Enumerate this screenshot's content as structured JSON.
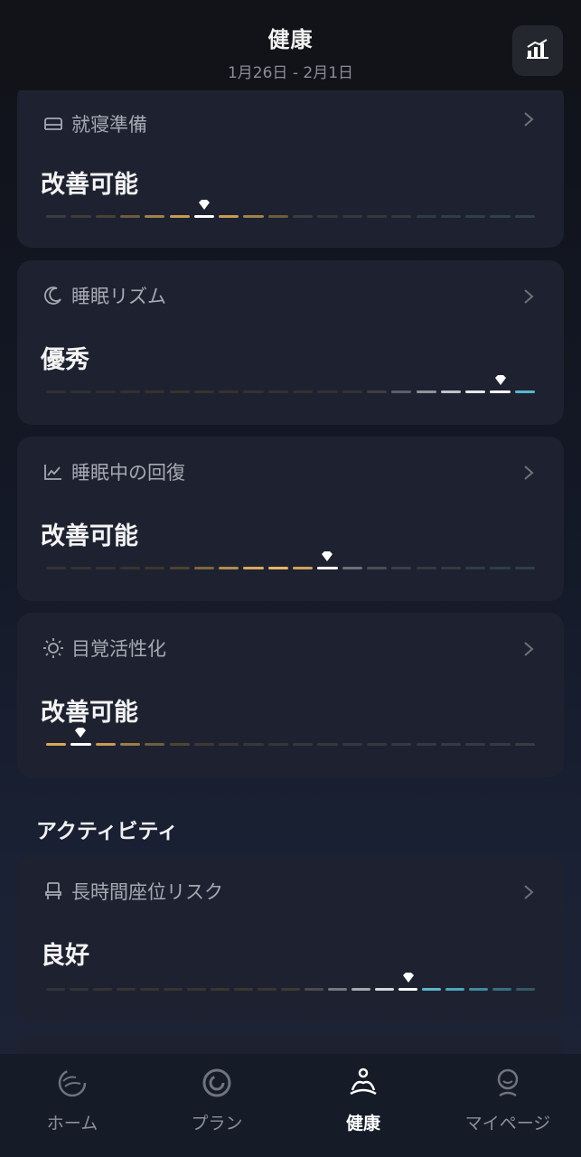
{
  "header": {
    "title": "健康",
    "date_range": "1月26日 - 2月1日",
    "stats_icon": "bar-chart-icon"
  },
  "cards": [
    {
      "id": "sleep-prep",
      "icon": "bed-icon",
      "label": "就寝準備",
      "rating": "改善可能",
      "marker_index": 6,
      "segment_colors": [
        "#3a3c42",
        "#3e3c3a",
        "#4a4234",
        "#6d5b3b",
        "#a0814a",
        "#c99a52",
        "#e6b062",
        "#c99a52",
        "#a0814a",
        "#6d5b3b",
        "#3a3c42",
        "#34383f",
        "#34383f",
        "#34383f",
        "#34383f",
        "#2f3a44",
        "#2e3d48",
        "#2e3e4a",
        "#2f3f4b",
        "#30404c"
      ]
    },
    {
      "id": "sleep-rhythm",
      "icon": "moon-icon",
      "label": "睡眠リズム",
      "rating": "優秀",
      "marker_index": 18,
      "segment_colors": [
        "#2f3034",
        "#2f3034",
        "#302f30",
        "#33302e",
        "#35312d",
        "#36322d",
        "#37332e",
        "#36322e",
        "#34312f",
        "#333131",
        "#323133",
        "#313134",
        "#323236",
        "#3c3e44",
        "#5c5f67",
        "#8e9299",
        "#bfc3c9",
        "#e4e6ea",
        "#6cc6d8",
        "#58b7cd"
      ]
    },
    {
      "id": "sleep-recovery",
      "icon": "line-chart-icon",
      "label": "睡眠中の回復",
      "rating": "改善可能",
      "marker_index": 11,
      "segment_colors": [
        "#323336",
        "#343334",
        "#363332",
        "#38342f",
        "#3c362e",
        "#4d4230",
        "#7c6540",
        "#b08d50",
        "#d8a95c",
        "#e8b565",
        "#d1a25a",
        "#8d9096",
        "#6d7077",
        "#4a4d54",
        "#3b3f47",
        "#34393f",
        "#2f3b44",
        "#2e3c47",
        "#2e3d48",
        "#2f3e4a"
      ]
    },
    {
      "id": "wake-activation",
      "icon": "sun-icon",
      "label": "目覚活性化",
      "rating": "改善可能",
      "marker_index": 1,
      "segment_colors": [
        "#d8a95c",
        "#e8b565",
        "#c89b55",
        "#9c7d48",
        "#6f5d3e",
        "#4d4535",
        "#3b3a38",
        "#36383b",
        "#34373c",
        "#33373d",
        "#33373e",
        "#33383f",
        "#333940",
        "#333941",
        "#333a42",
        "#333a43",
        "#333b44",
        "#333b45",
        "#333c46",
        "#343d47"
      ]
    },
    {
      "id": "sitting-risk",
      "icon": "chair-icon",
      "label": "長時間座位リスク",
      "rating": "良好",
      "marker_index": 15,
      "segment_colors": [
        "#323336",
        "#333335",
        "#343334",
        "#353433",
        "#363432",
        "#373531",
        "#383530",
        "#393630",
        "#3a3630",
        "#3b3730",
        "#3e3a33",
        "#4a4a4e",
        "#75787f",
        "#a5a8ae",
        "#d4d6da",
        "#f2f2f4",
        "#5cb8cc",
        "#4da6bd",
        "#3f8aa0",
        "#35707f",
        "#305a66"
      ]
    }
  ],
  "section": {
    "title": "アクティビティ"
  },
  "tabs": [
    {
      "id": "home",
      "label": "ホーム",
      "icon": "swirl-circle-icon",
      "active": false
    },
    {
      "id": "plan",
      "label": "プラン",
      "icon": "ring-icon",
      "active": false
    },
    {
      "id": "health",
      "label": "健康",
      "icon": "meditation-icon",
      "active": true
    },
    {
      "id": "mypage",
      "label": "マイページ",
      "icon": "person-icon",
      "active": false
    }
  ]
}
